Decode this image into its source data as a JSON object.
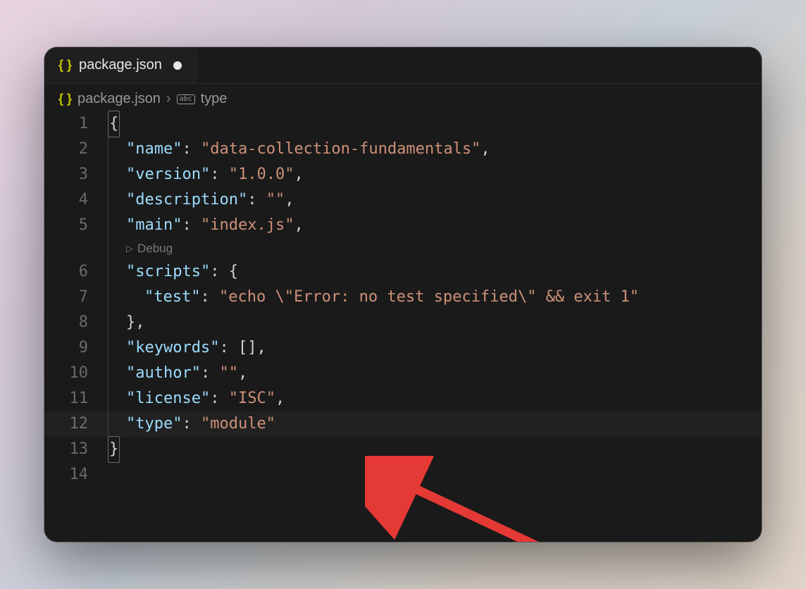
{
  "tab": {
    "filename": "package.json",
    "dirty": true
  },
  "breadcrumb": {
    "filename": "package.json",
    "symbol": "type"
  },
  "codelens": {
    "debug_label": "Debug"
  },
  "lines": {
    "numbers": [
      "1",
      "2",
      "3",
      "4",
      "5",
      "6",
      "7",
      "8",
      "9",
      "10",
      "11",
      "12",
      "13",
      "14"
    ],
    "content": [
      {
        "type": "open-brace",
        "text": "{"
      },
      {
        "type": "kv-str",
        "indent": 1,
        "key": "\"name\"",
        "value": "\"data-collection-fundamentals\"",
        "comma": true
      },
      {
        "type": "kv-str",
        "indent": 1,
        "key": "\"version\"",
        "value": "\"1.0.0\"",
        "comma": true
      },
      {
        "type": "kv-str",
        "indent": 1,
        "key": "\"description\"",
        "value": "\"\"",
        "comma": true
      },
      {
        "type": "kv-str",
        "indent": 1,
        "key": "\"main\"",
        "value": "\"index.js\"",
        "comma": true
      },
      {
        "type": "kv-open",
        "indent": 1,
        "key": "\"scripts\"",
        "open": "{"
      },
      {
        "type": "kv-str",
        "indent": 2,
        "key": "\"test\"",
        "value": "\"echo \\\"Error: no test specified\\\" && exit 1\"",
        "comma": false
      },
      {
        "type": "close",
        "indent": 1,
        "close": "}",
        "comma": true
      },
      {
        "type": "kv-lit",
        "indent": 1,
        "key": "\"keywords\"",
        "value": "[]",
        "comma": true
      },
      {
        "type": "kv-str",
        "indent": 1,
        "key": "\"author\"",
        "value": "\"\"",
        "comma": true
      },
      {
        "type": "kv-str",
        "indent": 1,
        "key": "\"license\"",
        "value": "\"ISC\"",
        "comma": true
      },
      {
        "type": "kv-str",
        "indent": 1,
        "key": "\"type\"",
        "value": "\"module\"",
        "comma": false,
        "current": true
      },
      {
        "type": "close-brace",
        "text": "}"
      },
      {
        "type": "blank"
      }
    ]
  },
  "colors": {
    "background": "#1a1a1a",
    "key": "#9cdcfe",
    "string": "#ce9178",
    "punctuation": "#d4d4d4",
    "icon_braces": "#c5c500",
    "arrow": "#e53935"
  }
}
